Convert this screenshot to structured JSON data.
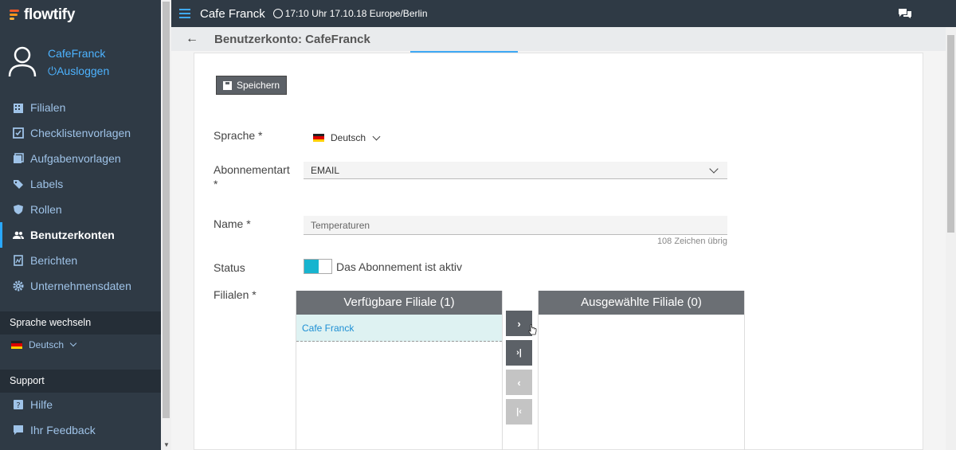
{
  "app": {
    "name": "flowtify"
  },
  "user": {
    "name": "CafeFranck",
    "logout": "⏻Ausloggen"
  },
  "nav": [
    {
      "label": "Filialen",
      "icon": "building-icon"
    },
    {
      "label": "Checklistenvorlagen",
      "icon": "checklist-icon"
    },
    {
      "label": "Aufgabenvorlagen",
      "icon": "task-template-icon"
    },
    {
      "label": "Labels",
      "icon": "tags-icon"
    },
    {
      "label": "Rollen",
      "icon": "shield-icon"
    },
    {
      "label": "Benutzerkonten",
      "icon": "users-icon",
      "active": true
    },
    {
      "label": "Berichten",
      "icon": "report-icon"
    },
    {
      "label": "Unternehmensdaten",
      "icon": "gear-icon"
    }
  ],
  "language_section": {
    "title": "Sprache wechseln",
    "current": "Deutsch"
  },
  "support_section": {
    "title": "Support",
    "items": [
      {
        "label": "Hilfe",
        "icon": "help-icon"
      },
      {
        "label": "Ihr Feedback",
        "icon": "feedback-icon"
      }
    ]
  },
  "topbar": {
    "company": "Cafe Franck",
    "datetime": "17:10 Uhr 17.10.18 Europe/Berlin"
  },
  "subheader": {
    "title": "Benutzerkonto: CafeFranck"
  },
  "form": {
    "save_label": "Speichern",
    "language_label": "Sprache *",
    "language_value": "Deutsch",
    "subscription_label": "Abonnementart *",
    "subscription_value": "EMAIL",
    "name_label": "Name *",
    "name_value": "Temperaturen",
    "name_counter": "108 Zeichen übrig",
    "status_label": "Status",
    "status_text": "Das Abonnement ist aktiv",
    "status_active": true,
    "branches_label": "Filialen  *",
    "available_title": "Verfügbare Filiale (1)",
    "available_items": [
      "Cafe Franck"
    ],
    "selected_title": "Ausgewählte Filiale (0)",
    "selected_items": []
  },
  "colors": {
    "sidebar_bg": "#2f3a45",
    "accent": "#3fa9f5",
    "toggle_on": "#17b4cf",
    "list_item_bg": "#def2f2"
  }
}
